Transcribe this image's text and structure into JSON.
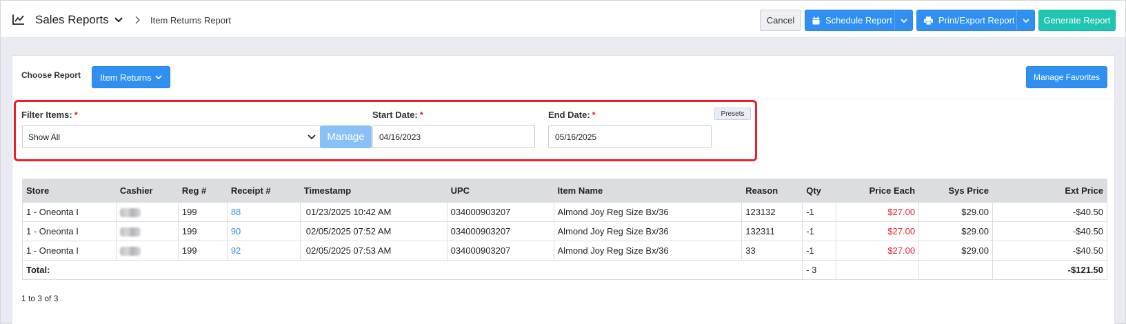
{
  "header": {
    "app_title": "Sales Reports",
    "breadcrumb": "Item Returns Report",
    "cancel_label": "Cancel",
    "schedule_label": "Schedule Report",
    "print_label": "Print/Export Report",
    "generate_label": "Generate Report"
  },
  "report": {
    "choose_label": "Choose Report",
    "selected": "Item Returns",
    "favorites_label": "Manage Favorites"
  },
  "filters": {
    "filter_items_label": "Filter Items:",
    "filter_value": "Show All",
    "manage_label": "Manage",
    "start_label": "Start Date:",
    "start_value": "04/16/2023",
    "end_label": "End Date:",
    "end_value": "05/16/2025",
    "presets_label": "Presets",
    "required_mark": "*"
  },
  "table": {
    "columns": [
      "Store",
      "Cashier",
      "Reg #",
      "Receipt #",
      "Timestamp",
      "UPC",
      "Item Name",
      "Reason",
      "Qty",
      "Price Each",
      "Sys Price",
      "Ext Price"
    ],
    "rows": [
      {
        "store": "1 - Oneonta I",
        "reg": "199",
        "receipt": "88",
        "timestamp": "01/23/2025 10:42 AM",
        "upc": "034000903207",
        "item": "Almond Joy Reg Size Bx/36",
        "reason": "123132",
        "qty": "-1",
        "price_each": "$27.00",
        "sys_price": "$29.00",
        "ext_price": "-$40.50"
      },
      {
        "store": "1 - Oneonta I",
        "reg": "199",
        "receipt": "90",
        "timestamp": "02/05/2025 07:52 AM",
        "upc": "034000903207",
        "item": "Almond Joy Reg Size Bx/36",
        "reason": "132311",
        "qty": "-1",
        "price_each": "$27.00",
        "sys_price": "$29.00",
        "ext_price": "-$40.50"
      },
      {
        "store": "1 - Oneonta I",
        "reg": "199",
        "receipt": "92",
        "timestamp": "02/05/2025 07:53 AM",
        "upc": "034000903207",
        "item": "Almond Joy Reg Size Bx/36",
        "reason": "33",
        "qty": "-1",
        "price_each": "$27.00",
        "sys_price": "$29.00",
        "ext_price": "-$40.50"
      }
    ],
    "total_label": "Total:",
    "total_qty": "- 3",
    "total_ext": "-$121.50"
  },
  "pager": {
    "text": "1 to 3 of 3"
  },
  "colors": {
    "primary": "#2f90f1",
    "teal": "#1ec5b0",
    "highlight": "#e8202a",
    "price_red": "#e8202a"
  }
}
